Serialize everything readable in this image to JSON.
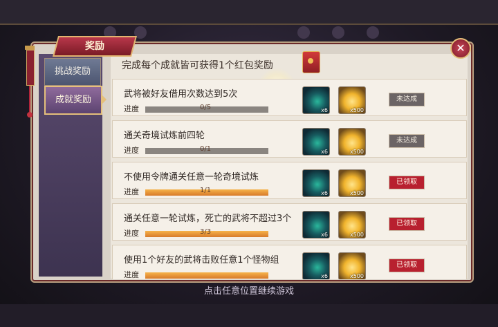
{
  "window": {
    "close_label": "✕"
  },
  "header": {
    "title": "奖励"
  },
  "tabs": [
    {
      "label": "挑战奖励",
      "active": false
    },
    {
      "label": "成就奖励",
      "active": true
    }
  ],
  "banner": {
    "text": "完成每个成就皆可获得1个红包奖励",
    "icon": "red-envelope-icon"
  },
  "progress_label": "进度",
  "rewards": [
    {
      "icon": "spirit-orb-icon",
      "qty": "x6"
    },
    {
      "icon": "gold-ingot-icon",
      "qty": "x500"
    }
  ],
  "tasks": [
    {
      "title": "武将被好友借用次数达到5次",
      "progress_text": "0/5",
      "fraction": 0,
      "status": "未达成",
      "state": "pending"
    },
    {
      "title": "通关奇境试炼前四轮",
      "progress_text": "0/1",
      "fraction": 0,
      "status": "未达成",
      "state": "pending"
    },
    {
      "title": "不使用令牌通关任意一轮奇境试炼",
      "progress_text": "1/1",
      "fraction": 1,
      "status": "已领取",
      "state": "claimed"
    },
    {
      "title": "通关任意一轮试炼，死亡的武将不超过3个",
      "progress_text": "3/3",
      "fraction": 1,
      "status": "已领取",
      "state": "claimed"
    },
    {
      "title": "使用1个好友的武将击败任意1个怪物组",
      "progress_text": "",
      "fraction": 1,
      "status": "已领取",
      "state": "claimed"
    }
  ],
  "footer": {
    "hint": "点击任意位置继续游戏"
  },
  "colors": {
    "claimed": "#b8202f",
    "pending": "#6b6465",
    "accent": "#e5c07b"
  }
}
